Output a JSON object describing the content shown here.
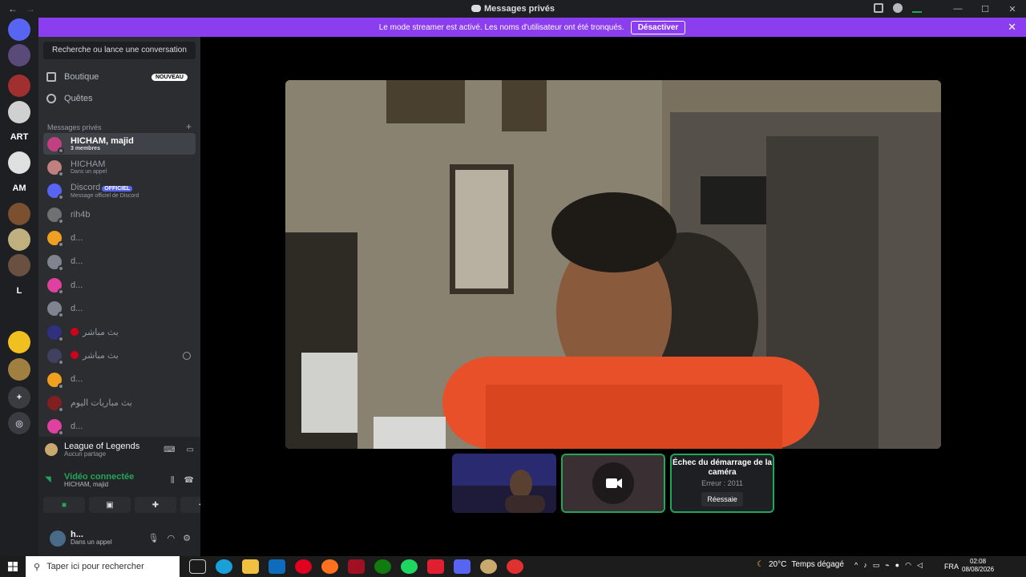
{
  "titlebar": {
    "title": "Messages privés"
  },
  "banner": {
    "text": "Le mode streamer est activé. Les noms d'utilisateur ont été tronqués.",
    "button": "Désactiver"
  },
  "servers": [
    {
      "label": "",
      "color": "#5865f2",
      "badge": ""
    },
    {
      "label": "",
      "color": "#5a4a7a",
      "badge": ""
    },
    {
      "label": "",
      "color": "#a03030",
      "badge": "14"
    },
    {
      "label": "",
      "color": "#d0d0d0",
      "badge": "269"
    },
    {
      "label": "ART",
      "color": "#1e1f22",
      "badge": ""
    },
    {
      "label": "",
      "color": "#e0e0e0",
      "badge": ""
    },
    {
      "label": "AM",
      "color": "#1e1f22",
      "badge": ""
    },
    {
      "label": "",
      "color": "#7a5030",
      "badge": "23"
    },
    {
      "label": "",
      "color": "#c0b080",
      "badge": "3"
    },
    {
      "label": "",
      "color": "#6a5040",
      "badge": ""
    },
    {
      "label": "L",
      "color": "#1e1f22",
      "badge": ""
    },
    {
      "label": "",
      "color": "#1e1f22",
      "badge": ""
    },
    {
      "label": "",
      "color": "#f0c020",
      "badge": ""
    },
    {
      "label": "",
      "color": "#a08040",
      "badge": ""
    }
  ],
  "sidebar": {
    "search_label": "Recherche ou lance une conversation",
    "shop": "Boutique",
    "shop_badge": "NOUVEAU",
    "quests": "Quêtes",
    "dm_header": "Messages privés",
    "dms": [
      {
        "name": "HICHAM, majid",
        "sub": "3 membres",
        "active": true,
        "color": "#c04080"
      },
      {
        "name": "HICHAM",
        "sub": "Dans un appel",
        "active": false,
        "color": "#c08080"
      },
      {
        "name": "Discord",
        "sub": "Message officiel de Discord",
        "tag": "OFFICIEL",
        "active": false,
        "color": "#5865f2"
      },
      {
        "name": "rih4b",
        "sub": "",
        "active": false,
        "color": "#707070"
      },
      {
        "name": "d...",
        "sub": "",
        "active": false,
        "color": "#f0a020"
      },
      {
        "name": "d...",
        "sub": "",
        "active": false,
        "color": "#80848e"
      },
      {
        "name": "d...",
        "sub": "",
        "active": false,
        "color": "#e040a0"
      },
      {
        "name": "d...",
        "sub": "",
        "active": false,
        "color": "#80848e"
      },
      {
        "name": "بث مباشر",
        "sub": "",
        "active": false,
        "color": "#303080",
        "live": true
      },
      {
        "name": "بث مباشر",
        "sub": "",
        "active": false,
        "color": "#404060",
        "live": true,
        "blocked": true
      },
      {
        "name": "d...",
        "sub": "",
        "active": false,
        "color": "#f0a020"
      },
      {
        "name": "بث مباريات اليوم",
        "sub": "",
        "active": false,
        "color": "#802020"
      },
      {
        "name": "d...",
        "sub": "",
        "active": false,
        "color": "#e040a0"
      }
    ]
  },
  "panel": {
    "game_title": "League of Legends",
    "game_sub": "Aucun partage",
    "voice_title": "Vidéo connectée",
    "voice_sub": "HICHAM, majid",
    "user_name": "h...",
    "user_status": "Dans un appel"
  },
  "stage": {
    "error_title": "Échec du démarrage de la caméra",
    "error_code": "Erreur : 2011",
    "retry": "Réessaie"
  },
  "taskbar": {
    "search": "Taper ici pour rechercher",
    "temp": "20°C",
    "weather": "Temps dégagé",
    "lang": "FRA",
    "time": "02:08",
    "date": "08/08/2026"
  },
  "colors": {
    "accent": "#5865f2",
    "banner": "#8b3df0",
    "green": "#23a55a"
  }
}
